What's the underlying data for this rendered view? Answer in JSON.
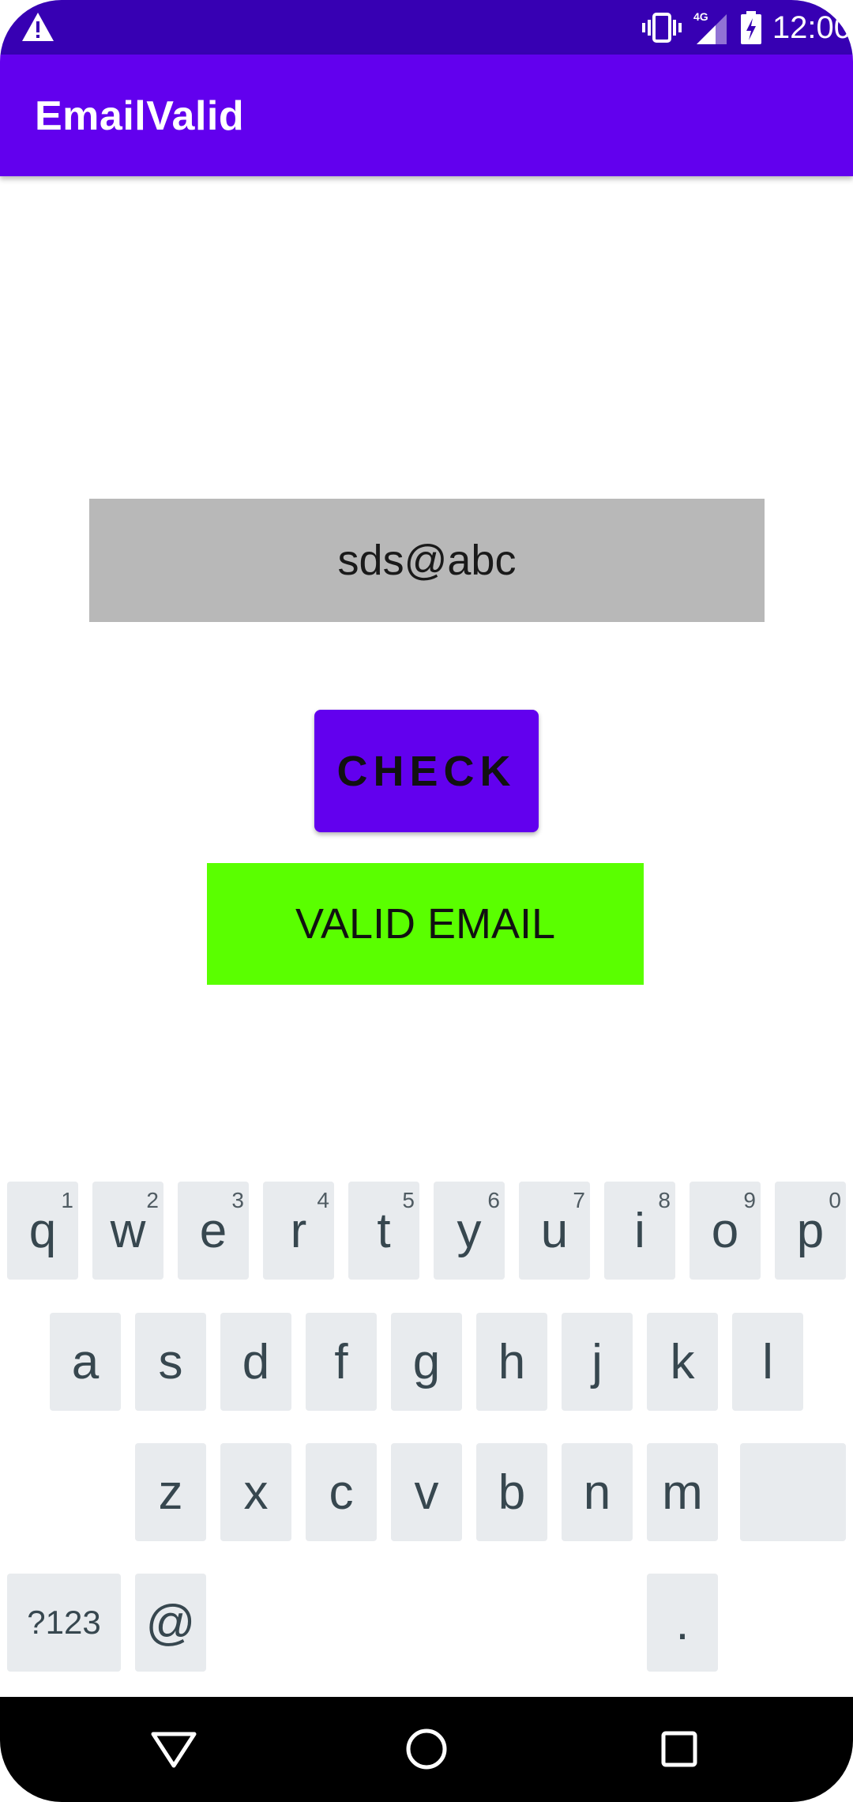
{
  "status_bar": {
    "time": "12:00",
    "icons": [
      "warning-icon",
      "vibrate-icon",
      "signal-4g-icon",
      "battery-charging-icon"
    ]
  },
  "app_bar": {
    "title": "EmailValid"
  },
  "email_input": {
    "value": "sds@abc"
  },
  "check_button": {
    "label": "CHECK",
    "color": "#6200ee"
  },
  "result": {
    "text": "VALID EMAIL",
    "color": "#5aff00"
  },
  "keyboard": {
    "row1": [
      {
        "key": "q",
        "hint": "1"
      },
      {
        "key": "w",
        "hint": "2"
      },
      {
        "key": "e",
        "hint": "3"
      },
      {
        "key": "r",
        "hint": "4"
      },
      {
        "key": "t",
        "hint": "5"
      },
      {
        "key": "y",
        "hint": "6"
      },
      {
        "key": "u",
        "hint": "7"
      },
      {
        "key": "i",
        "hint": "8"
      },
      {
        "key": "o",
        "hint": "9"
      },
      {
        "key": "p",
        "hint": "0"
      }
    ],
    "row2": [
      "a",
      "s",
      "d",
      "f",
      "g",
      "h",
      "j",
      "k",
      "l"
    ],
    "row3": [
      "z",
      "x",
      "c",
      "v",
      "b",
      "n",
      "m"
    ],
    "symbols_key": "?123",
    "at_key": "@",
    "period_key": "."
  },
  "colors": {
    "status_bar": "#3700b3",
    "app_bar": "#6200ee",
    "input_background": "#b8b8b8",
    "key_background": "#e8ebee"
  }
}
